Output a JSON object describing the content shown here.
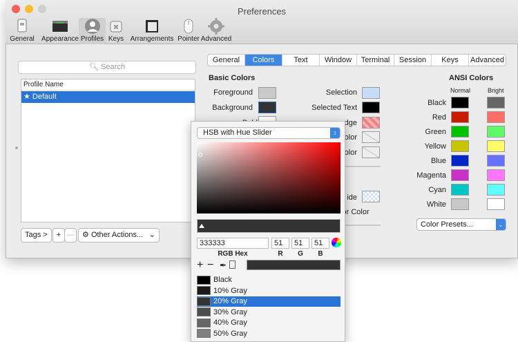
{
  "window": {
    "title": "Preferences"
  },
  "toolbar": {
    "items": [
      {
        "label": "General"
      },
      {
        "label": "Appearance"
      },
      {
        "label": "Profiles"
      },
      {
        "label": "Keys"
      },
      {
        "label": "Arrangements"
      },
      {
        "label": "Pointer"
      },
      {
        "label": "Advanced"
      }
    ]
  },
  "sidebar": {
    "search_placeholder": "Search",
    "list_header": "Profile Name",
    "profiles": [
      "★ Default"
    ],
    "tags_label": "Tags >",
    "add_label": "+",
    "remove_label": "—",
    "other_actions_label": "Other Actions...",
    "other_actions_icon": "gear-icon"
  },
  "tabs": [
    "General",
    "Colors",
    "Text",
    "Window",
    "Terminal",
    "Session",
    "Keys",
    "Advanced"
  ],
  "basic_colors": {
    "heading": "Basic Colors",
    "left": [
      {
        "label": "Foreground",
        "color": "#c9c9c9"
      },
      {
        "label": "Background",
        "color": "#333333"
      }
    ],
    "right": [
      {
        "label": "Selection",
        "color": "#c6dcf8"
      },
      {
        "label": "Selected Text",
        "color": "#000000"
      }
    ],
    "partial": {
      "bold": "Bold",
      "badge": "dge",
      "cursor1": "olor",
      "cursor2": "olor",
      "side": "ide",
      "cursor_color": "sor Color"
    }
  },
  "ansi": {
    "heading": "ANSI Colors",
    "normal_label": "Normal",
    "bright_label": "Bright",
    "rows": [
      {
        "name": "Black",
        "normal": "#000000",
        "bright": "#666666"
      },
      {
        "name": "Red",
        "normal": "#c91b00",
        "bright": "#ff6e67"
      },
      {
        "name": "Green",
        "normal": "#00c200",
        "bright": "#5ffa68"
      },
      {
        "name": "Yellow",
        "normal": "#c7c400",
        "bright": "#fffc67"
      },
      {
        "name": "Blue",
        "normal": "#0225c7",
        "bright": "#6871ff"
      },
      {
        "name": "Magenta",
        "normal": "#c930c7",
        "bright": "#ff77ff"
      },
      {
        "name": "Cyan",
        "normal": "#00c5c7",
        "bright": "#60fdff"
      },
      {
        "name": "White",
        "normal": "#c7c7c7",
        "bright": "#ffffff"
      }
    ],
    "presets_label": "Color Presets..."
  },
  "color_picker": {
    "mode": "HSB with Hue Slider",
    "hex": "333333",
    "r": "51",
    "g": "51",
    "b": "51",
    "hex_caption": "RGB Hex",
    "r_caption": "R",
    "g_caption": "G",
    "b_caption": "B",
    "current_color": "#333333",
    "swatches": [
      {
        "label": "Black",
        "color": "#000000"
      },
      {
        "label": "10% Gray",
        "color": "#1a1a1a"
      },
      {
        "label": "20% Gray",
        "color": "#333333"
      },
      {
        "label": "30% Gray",
        "color": "#4d4d4d"
      },
      {
        "label": "40% Gray",
        "color": "#666666"
      },
      {
        "label": "50% Gray",
        "color": "#808080"
      }
    ],
    "selected_swatch": 2
  }
}
